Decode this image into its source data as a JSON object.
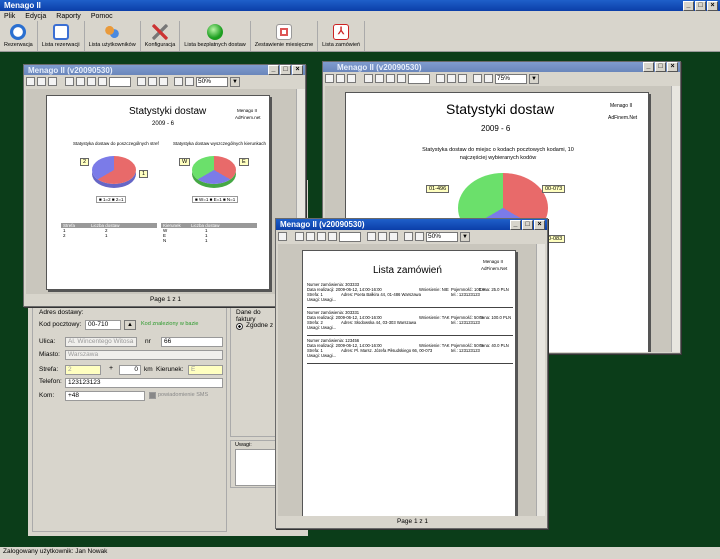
{
  "app": {
    "title": "Menago II"
  },
  "menu": [
    "Plik",
    "Edycja",
    "Raporty",
    "Pomoc"
  ],
  "toolbar": [
    {
      "label": "Rezerwacja",
      "icon": "clock-icon"
    },
    {
      "label": "Lista rezerwacji",
      "icon": "calendar-icon"
    },
    {
      "label": "Lista użytkowników",
      "icon": "users-icon"
    },
    {
      "label": "Konfiguracja",
      "icon": "tools-icon"
    },
    {
      "label": "Lista bezpłatnych dostaw",
      "icon": "green-ball-icon"
    },
    {
      "label": "Zestawienie miesięczne",
      "icon": "document-icon"
    },
    {
      "label": "Lista zamówień",
      "icon": "pdf-icon"
    }
  ],
  "form": {
    "section_address": "Adres dostawy:",
    "postal_label": "Kod pocztowy:",
    "postal_value": "00-710",
    "postal_note": "Kod znaleziony w bazie",
    "street_label": "Ulica:",
    "street_value": "Al. Wincentego Witosa",
    "nr_label": "nr",
    "nr_value": "66",
    "city_label": "Miasto:",
    "city_value": "Warszawa",
    "zone_label": "Strefa:",
    "zone_value": "2",
    "plus": "+",
    "km_value": "0",
    "km_unit": "km",
    "direction_label": "Kierunek:",
    "direction_value": "E",
    "phone_label": "Telefon:",
    "phone_value": "123123123",
    "kom_label": "Kom:",
    "kom_value": "+48",
    "sms_label": "powiadomienie SMS",
    "invoice_label": "Dane do faktury",
    "invoice_option": "Zgodne z ",
    "notes_label": "Uwagi:"
  },
  "status_bar": "Zalogowany użytkownik: Jan Nowak",
  "win1": {
    "title": "Menago II (v20090530)",
    "zoom": "50%",
    "page_label": "Page 1 z 1",
    "report_title": "Statystyki dostaw",
    "report_date": "2009 - 6",
    "brand": "Menago II",
    "brand_sub": "AdFinem.net",
    "chart1_title": "Statystyka dostaw do poszczególnych stref",
    "chart2_title": "Statystyka dostaw wyszczególnych kierunkach",
    "legend1": "■ 1=2  ■ 2=1",
    "legend2": "■ W=1 ■ E=1 ■ N=1",
    "tag1a": "2",
    "tag1b": "1",
    "tag2a": "W",
    "tag2b": "E",
    "table_left_headers": [
      "Strefa",
      "Liczba dostaw"
    ],
    "table_left_rows": [
      [
        "1",
        "2"
      ],
      [
        "2",
        "1"
      ]
    ],
    "table_right_headers": [
      "Kierunek",
      "Liczba dostaw"
    ],
    "table_right_rows": [
      [
        "W",
        "1"
      ],
      [
        "E",
        "1"
      ],
      [
        "N",
        "1"
      ]
    ]
  },
  "win2": {
    "title": "Menago II (v20090530)",
    "zoom": "75%",
    "report_title": "Statystyki dostaw",
    "report_date": "2009 - 6",
    "brand": "Menago II",
    "brand_sub": "AdFinem.Net",
    "chart_title": "Statystyka dostaw do miejsc o kodach pocztowych kodami, 10 najczęściej wybieranych kodów",
    "tag_left": "01-496",
    "tag_right": "00-073",
    "tag_bottom": "00-083"
  },
  "win3": {
    "title": "Menago II (v20090530)",
    "zoom": "50%",
    "page_label": "Page 1 z 1",
    "report_title": "Lista zamówień",
    "brand": "Menago II",
    "brand_sub": "AdFinem.Net",
    "orders": [
      {
        "nr": "Numer zamówienia: 303333",
        "date": "Data realizacji: 2009-06-12, 14:00-16:00",
        "wyn": "Wniesienie: NIE",
        "poj": "Pojemność: 100 %",
        "cena": "Cena: 25.0  PLN",
        "strefa": "Strefa: 1",
        "adres": "Adres: Poeta Bałkira 44, 01-486 Warszawa",
        "tel": "tel.: 123123123",
        "uwagi": "Uwagi: Uwagi..."
      },
      {
        "nr": "Numer zamówienia: 303331",
        "date": "Data realizacji: 2009-06-12, 14:00-16:00",
        "wyn": "Wniesienie: TAK",
        "poj": "Pojemność: 50 %",
        "cena": "Cena: 100.0  PLN",
        "strefa": "Strefa: 2",
        "adres": "Adres: Słodowska 44, 03-303 Warszawa",
        "tel": "tel.: 123123123",
        "uwagi": "Uwagi: Uwagi..."
      },
      {
        "nr": "Numer zamówienia: 123456",
        "date": "Data realizacji: 2009-06-12, 14:00-16:00",
        "wyn": "Wniesienie: TAK",
        "poj": "Pojemność: 50 %",
        "cena": "Cena: 40.0  PLN",
        "strefa": "Strefa: 1",
        "adres": "Adres: Pl. Marsz. Józefa Piłsudskiego 66, 00-073",
        "tel": "tel.: 123123123",
        "uwagi": "Uwagi: Uwagi..."
      }
    ]
  }
}
